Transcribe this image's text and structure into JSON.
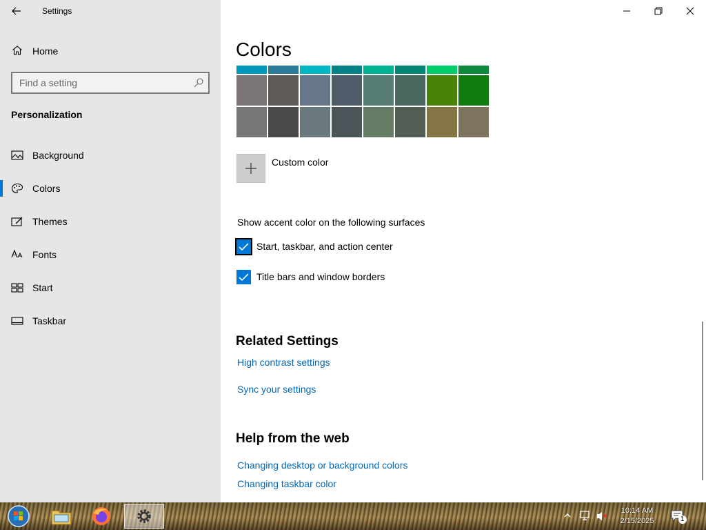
{
  "window": {
    "app_title": "Settings"
  },
  "sidebar": {
    "home_label": "Home",
    "search_placeholder": "Find a setting",
    "section_title": "Personalization",
    "items": [
      {
        "label": "Background",
        "icon": "picture-icon",
        "selected": false
      },
      {
        "label": "Colors",
        "icon": "palette-icon",
        "selected": true
      },
      {
        "label": "Themes",
        "icon": "themes-icon",
        "selected": false
      },
      {
        "label": "Fonts",
        "icon": "fonts-icon",
        "selected": false
      },
      {
        "label": "Start",
        "icon": "start-icon",
        "selected": false
      },
      {
        "label": "Taskbar",
        "icon": "taskbar-icon",
        "selected": false
      }
    ]
  },
  "main": {
    "title": "Colors",
    "swatch_rows": [
      [
        "#0099bc",
        "#2d7d9a",
        "#00b7c3",
        "#038387",
        "#00b294",
        "#018574",
        "#00cc6a",
        "#10893e"
      ],
      [
        "#7a7574",
        "#5d5a58",
        "#68768a",
        "#515c6b",
        "#567c73",
        "#486860",
        "#498205",
        "#107c10"
      ],
      [
        "#767676",
        "#4c4a48",
        "#69797e",
        "#4a5459",
        "#647c64",
        "#525e54",
        "#847545",
        "#7e735f"
      ]
    ],
    "custom_color_label": "Custom color",
    "surfaces_heading": "Show accent color on the following surfaces",
    "checkboxes": [
      {
        "label": "Start, taskbar, and action center",
        "checked": true
      },
      {
        "label": "Title bars and window borders",
        "checked": true
      }
    ],
    "related_heading": "Related Settings",
    "related_links": [
      "High contrast settings",
      "Sync your settings"
    ],
    "help_heading": "Help from the web",
    "help_links": [
      "Changing desktop or background colors",
      "Changing taskbar color"
    ]
  },
  "taskbar": {
    "time": "10:14 AM",
    "date": "2/15/2025",
    "notification_count": "1",
    "apps": [
      "file-explorer-icon",
      "firefox-icon",
      "settings-gear-icon"
    ]
  },
  "colors": {
    "accent": "#0078d7",
    "link": "#0067b8",
    "sidebar_bg": "#e6e6e6"
  }
}
